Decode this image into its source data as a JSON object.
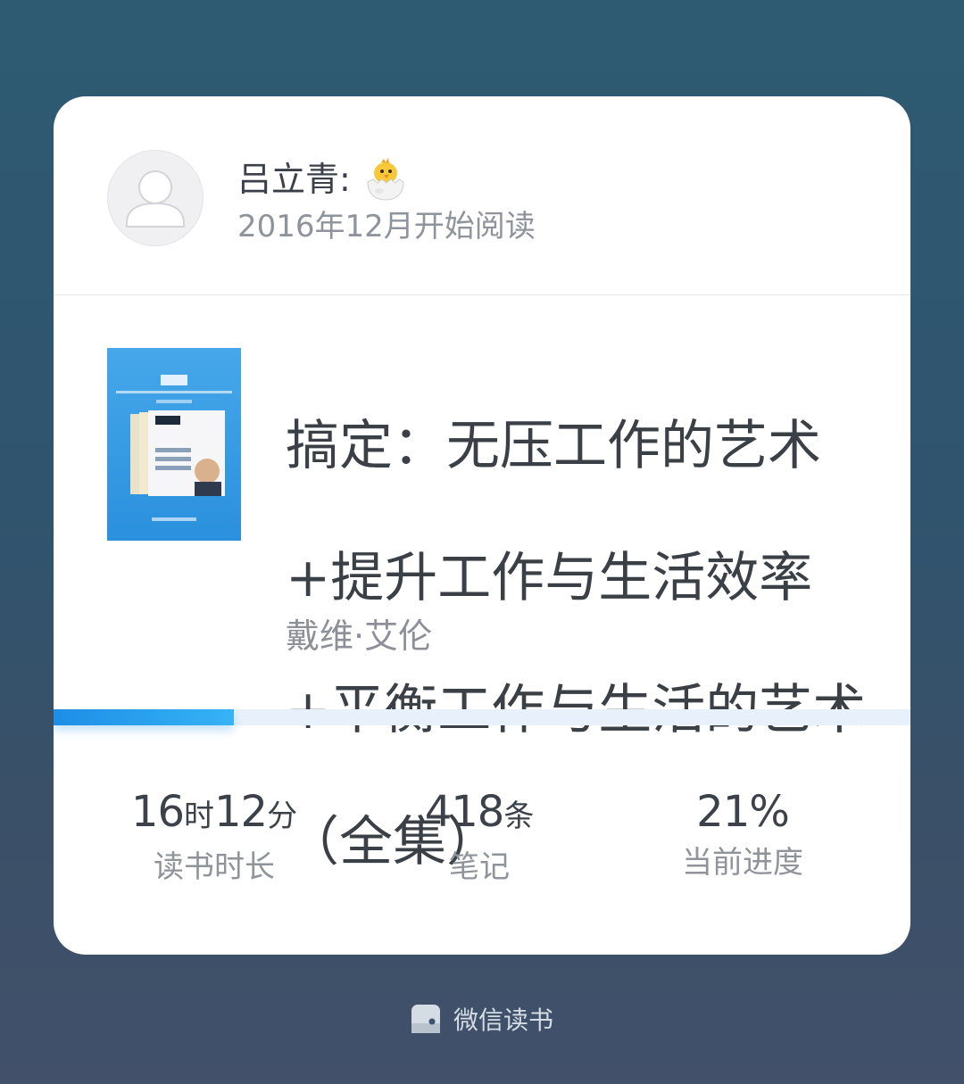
{
  "user": {
    "name": "吕立青:",
    "status_emoji": "hatching-chick",
    "since": "2016年12月开始阅读"
  },
  "book": {
    "title_lines": [
      "搞定：无压工作的艺术",
      "+提升工作与生活效率",
      "+平衡工作与生活的艺术",
      "（全集）"
    ],
    "author": "戴维·艾伦"
  },
  "progress": {
    "fraction": 0.21,
    "color_start": "#1e8ee6",
    "color_end": "#36b3f5"
  },
  "stats": [
    {
      "parts": [
        {
          "v": "16"
        },
        {
          "u": "时"
        },
        {
          "v": "12"
        },
        {
          "u": "分"
        }
      ],
      "label": "读书时长"
    },
    {
      "parts": [
        {
          "v": "418"
        },
        {
          "u": "条"
        }
      ],
      "label": "笔记"
    },
    {
      "parts": [
        {
          "v": "21%"
        }
      ],
      "label": "当前进度"
    }
  ],
  "footer": {
    "icon": "weread-logo-icon",
    "text": "微信读书"
  }
}
